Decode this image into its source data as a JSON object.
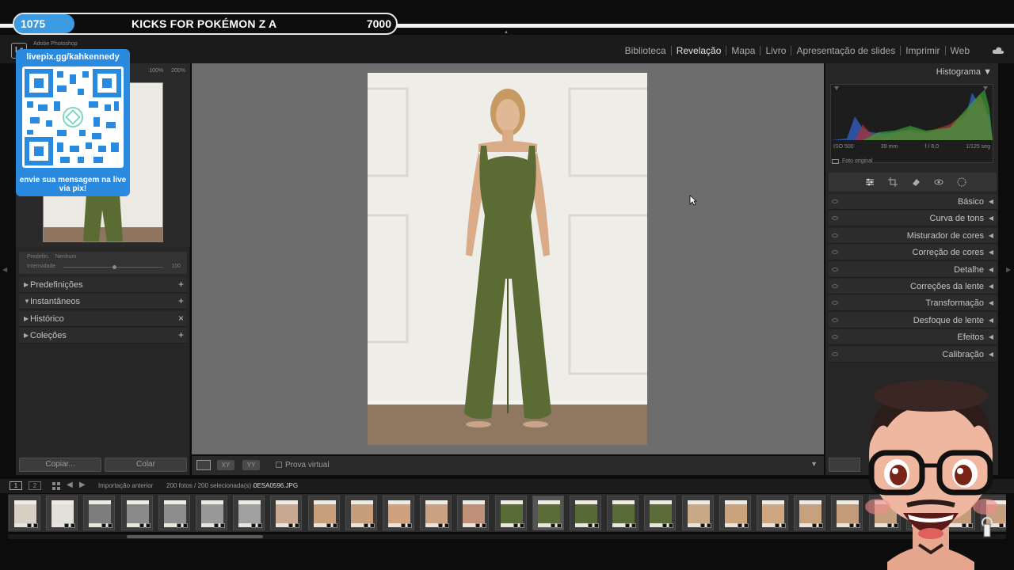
{
  "app": {
    "name": "Adobe Photoshop",
    "logo_text": "Lr"
  },
  "modules": [
    {
      "label": "Biblioteca",
      "active": false
    },
    {
      "label": "Revelação",
      "active": true
    },
    {
      "label": "Mapa",
      "active": false
    },
    {
      "label": "Livro",
      "active": false
    },
    {
      "label": "Apresentação de slides",
      "active": false
    },
    {
      "label": "Imprimir",
      "active": false
    },
    {
      "label": "Web",
      "active": false
    }
  ],
  "stream": {
    "count": "1075",
    "title": "KICKS FOR POKÉMON Z A",
    "goal": "7000"
  },
  "pix": {
    "url": "livepix.gg/kahkennedy",
    "message": "envie sua mensagem na live via pix!"
  },
  "navigator": {
    "zoom_options": [
      "100%",
      "200%"
    ]
  },
  "preset_amount": {
    "preset_label": "Predefin.",
    "preset_value": "Nenhum",
    "amount_label": "Intensidade",
    "amount_value": "100"
  },
  "left_sections": [
    {
      "label": "Predefinições",
      "action": "+",
      "expanded": false
    },
    {
      "label": "Instantâneos",
      "action": "+",
      "expanded": true
    },
    {
      "label": "Histórico",
      "action": "×",
      "expanded": false
    },
    {
      "label": "Coleções",
      "action": "+",
      "expanded": false
    }
  ],
  "left_buttons": {
    "copy": "Copiar...",
    "paste": "Colar"
  },
  "toolbar": {
    "soft_proof": "Prova virtual",
    "compare": "XY",
    "survey": "YY"
  },
  "histogram": {
    "title": "Histograma",
    "iso": "ISO 500",
    "focal": "39 mm",
    "aperture": "f / 8,0",
    "shutter": "1/125 seg",
    "original_photo": "Foto original"
  },
  "tool_icons": [
    "sliders-icon",
    "crop-icon",
    "eraser-icon",
    "redeye-icon",
    "mask-icon"
  ],
  "right_sections": [
    "Básico",
    "Curva de tons",
    "Misturador de cores",
    "Correção de cores",
    "Detalhe",
    "Correções da lente",
    "Transformação",
    "Desfoque de lente",
    "Efeitos",
    "Calibração"
  ],
  "filmstrip_bar": {
    "page1": "1",
    "page2": "2",
    "source": "Importação anterior",
    "count": "200 fotos / 200 selecionada(s) /",
    "file": "0ESA0596.JPG"
  },
  "filmstrip": {
    "thumb_tones": [
      "#d8cfc4",
      "#e3dfd9",
      "#7d7d7d",
      "#8a8a8a",
      "#8d8d8d",
      "#999",
      "#a0a0a0",
      "#c8a890",
      "#c79f7a",
      "#c79e7c",
      "#cfa27f",
      "#c9a183",
      "#bf8f78",
      "#566b35",
      "#5a6c38",
      "#556a34",
      "#566b35",
      "#5b6c3a",
      "#c9a888",
      "#caa27c",
      "#cea67f",
      "#c7a07e",
      "#c49b79",
      "#c4a07e",
      "#c9a37e",
      "#c39e79",
      "#c5a07f"
    ],
    "selected_index": 14
  },
  "colors": {
    "accent_blue": "#2a8ae0",
    "jumpsuit": "#5a6b34",
    "panel_bg": "#262626",
    "canvas_bg": "#6d6d6d"
  }
}
